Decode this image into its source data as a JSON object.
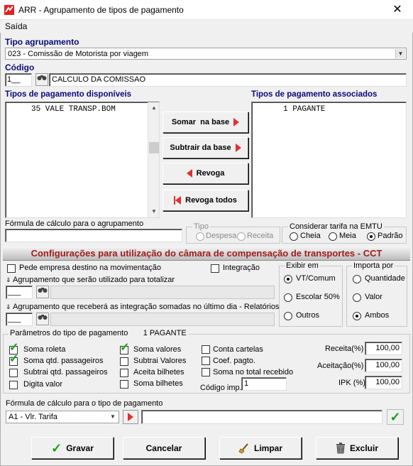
{
  "window": {
    "title": "ARR - Agrupamento de tipos de pagamento",
    "close_glyph": "✕"
  },
  "menu": {
    "saida": "Saída"
  },
  "tipo_agrupamento": {
    "label": "Tipo agrupamento",
    "value": "023 - Comissão de Motorista por viagem"
  },
  "codigo": {
    "label": "Código",
    "code": "1__",
    "description": "CALCULO DA COMISSAO"
  },
  "disponiveis": {
    "label": "Tipos de pagamento disponíveis",
    "items": [
      "35 VALE TRANSP.BOM"
    ]
  },
  "associados": {
    "label": "Tipos de pagamento associados",
    "items": [
      "1 PAGANTE"
    ]
  },
  "mid_buttons": {
    "somar": "Somar  na base",
    "subtrair": "Subtrair da base",
    "revoga": "Revoga",
    "revoga_todos": "Revoga todos"
  },
  "formula_agrupamento": {
    "label": "Fórmula de cálculo para o agrupamento",
    "value": ""
  },
  "tipo": {
    "label": "Tipo",
    "despesa": "Despesa",
    "receita": "Receita"
  },
  "tarifa": {
    "label": "Considerar tarifa na EMTU",
    "cheia": "Cheia",
    "meia": "Meia",
    "padrao": "Padrão",
    "selected": "Padrão"
  },
  "cct": {
    "banner": "Configurações para utilização do câmara de compensação de transportes - CCT",
    "pede_empresa": "Pede empresa destino na movimentação",
    "integracao": "Integração",
    "agrup_totalizar": "Agrupamento que serão utilizado para totalizar",
    "agrup_integracao": "Agrupamento que receberá as integração somadas no último dia - Relatórios",
    "code1": "___",
    "code2": "___"
  },
  "exibir_em": {
    "label": "Exibir em",
    "vt": "VT/Comum",
    "escolar": "Escolar 50%",
    "outros": "Outros",
    "selected": "VT/Comum"
  },
  "importa_por": {
    "label": "Importa por",
    "quantidade": "Quantidade",
    "valor": "Valor",
    "ambos": "Ambos",
    "selected": "Ambos"
  },
  "parametros": {
    "label": "Parâmetros do tipo de pagamento",
    "tipo_atual": "1 PAGANTE",
    "col1": [
      {
        "label": "Soma roleta",
        "checked": true
      },
      {
        "label": "Soma qtd. passageiros",
        "checked": true
      },
      {
        "label": "Subtrai qtd. passageiros",
        "checked": false
      },
      {
        "label": "Digita valor",
        "checked": false
      }
    ],
    "col2": [
      {
        "label": "Soma valores",
        "checked": true
      },
      {
        "label": "Subtrai Valores",
        "checked": false
      },
      {
        "label": "Aceita bilhetes",
        "checked": false
      },
      {
        "label": "Soma bilhetes",
        "checked": false
      }
    ],
    "col3": [
      {
        "label": "Conta cartelas",
        "checked": false
      },
      {
        "label": "Coef. pagto.",
        "checked": false
      },
      {
        "label": "Soma no total recebido",
        "checked": false
      }
    ],
    "codigo_imp_label": "Código imp.",
    "codigo_imp": "1",
    "receita_label": "Receita(%)",
    "receita": "100,00",
    "aceitacao_label": "Aceitação(%)",
    "aceitacao": "100,00",
    "ipk_label": "IPK (%)",
    "ipk": "100,00"
  },
  "formula_tipo": {
    "label": "Fórmula de cálculo para o tipo de pagamento",
    "selected": "A1 - Vlr. Tarifa",
    "value": ""
  },
  "footer": {
    "gravar": "Gravar",
    "cancelar": "Cancelar",
    "limpar": "Limpar",
    "excluir": "Excluir"
  },
  "colors": {
    "title_blue": "#0a0a7a",
    "banner_red": "#a01c1c",
    "arrow_red": "#e03030",
    "check_green": "#16a016"
  }
}
